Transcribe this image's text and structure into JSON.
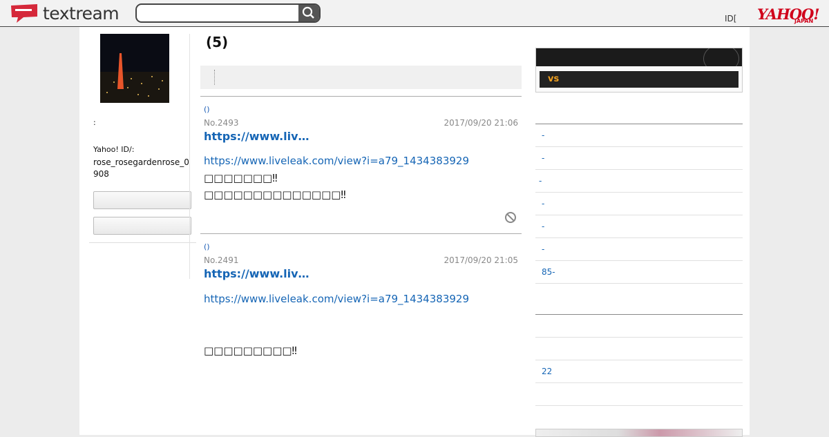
{
  "header": {
    "logo_text": "textream",
    "search_placeholder": "",
    "id_text": "ID[",
    "yahoo_text": "YAHOO!",
    "yahoo_sub": "JAPAN"
  },
  "profile": {
    "colon": ":",
    "yid_label": "Yahoo! ID/:",
    "yid_value": "rose_rosegardenrose_0908"
  },
  "main": {
    "title": "(5)",
    "posts": [
      {
        "author": "()",
        "no": "No.2493",
        "date": "2017/09/20 21:06",
        "title": "https://www.liv…",
        "link": "https://www.liveleak.com/view?i=a79_1434383929",
        "text_lines": [
          "□□□□□□□‼",
          "□□□□□□□□□□□□□□‼"
        ]
      },
      {
        "author": "()",
        "no": "No.2491",
        "date": "2017/09/20 21:05",
        "title": "https://www.liv…",
        "link": "https://www.liveleak.com/view?i=a79_1434383929",
        "text_lines": [
          "□□□□□□□□□‼"
        ]
      }
    ]
  },
  "side": {
    "sports_vs": "vs",
    "list1": [
      "-",
      "-",
      "-",
      "-",
      "-",
      "-",
      "85-",
      ""
    ],
    "list2": [
      "",
      "22",
      ""
    ]
  }
}
